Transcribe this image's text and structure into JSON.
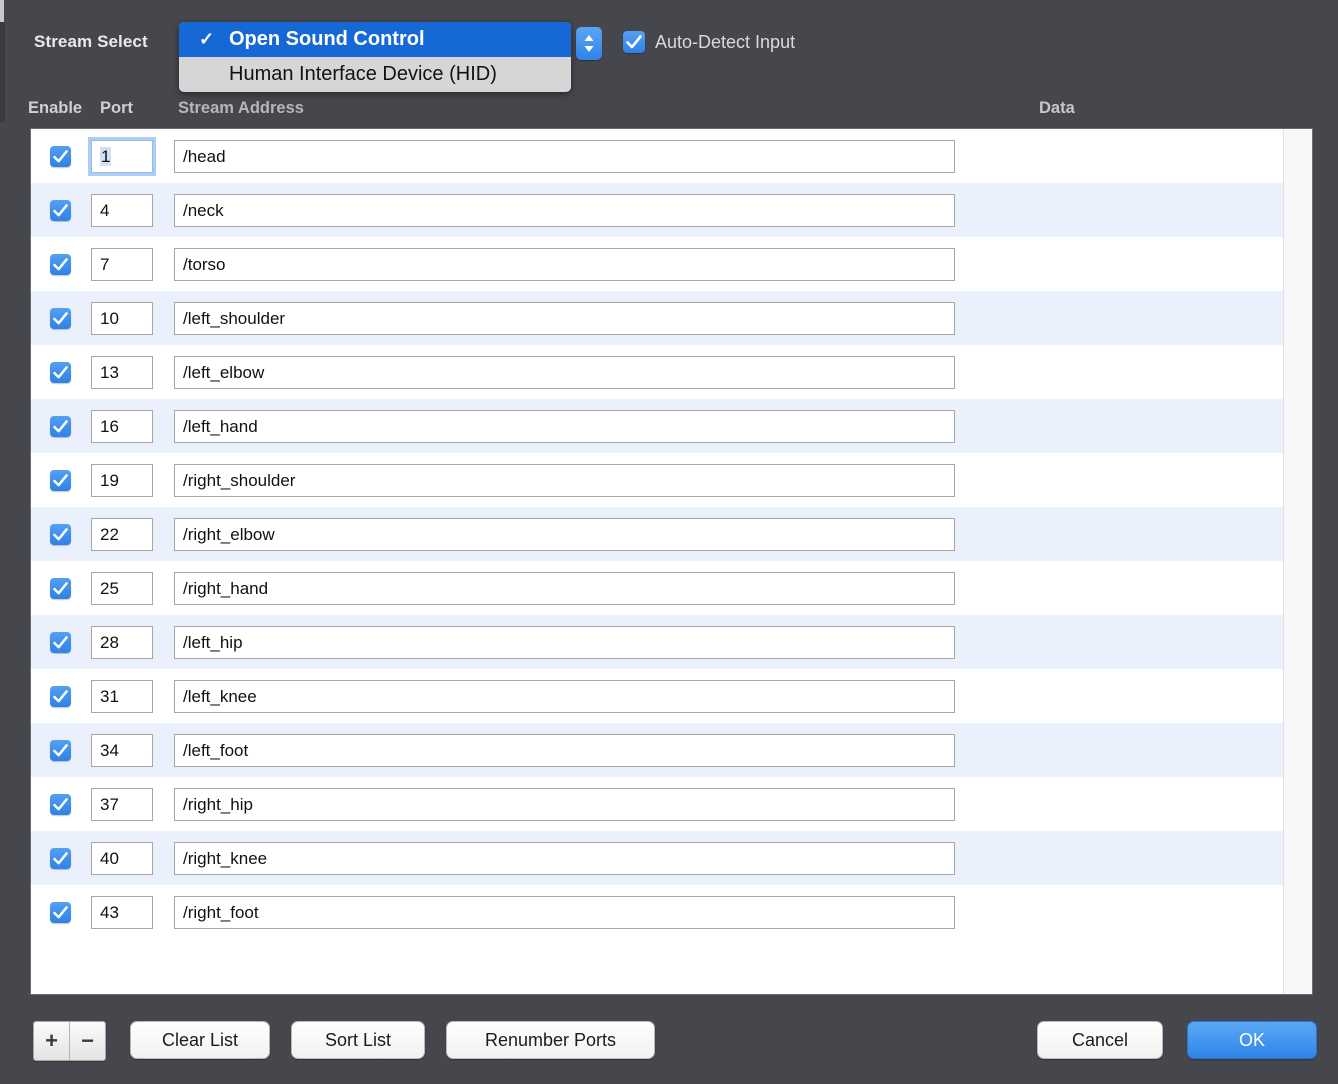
{
  "window": {
    "background_color": "#46464d",
    "accent_color": "#2f85e9"
  },
  "header": {
    "stream_select_label": "Stream Select",
    "auto_detect": {
      "label": "Auto-Detect Input",
      "checked": true
    },
    "stream_type_menu": {
      "open": true,
      "selected": "Open Sound Control",
      "options": [
        {
          "label": "Open Sound Control",
          "checked": true
        },
        {
          "label": "Human Interface Device (HID)",
          "checked": false
        }
      ],
      "checkmark_glyph": "✓"
    }
  },
  "table": {
    "columns": {
      "enable": "Enable",
      "port": "Port",
      "address": "Stream Address",
      "data": "Data"
    },
    "rows": [
      {
        "enabled": true,
        "port": "1",
        "address": "/head",
        "data": "",
        "focused": true
      },
      {
        "enabled": true,
        "port": "4",
        "address": "/neck",
        "data": "",
        "focused": false
      },
      {
        "enabled": true,
        "port": "7",
        "address": "/torso",
        "data": "",
        "focused": false
      },
      {
        "enabled": true,
        "port": "10",
        "address": "/left_shoulder",
        "data": "",
        "focused": false
      },
      {
        "enabled": true,
        "port": "13",
        "address": "/left_elbow",
        "data": "",
        "focused": false
      },
      {
        "enabled": true,
        "port": "16",
        "address": "/left_hand",
        "data": "",
        "focused": false
      },
      {
        "enabled": true,
        "port": "19",
        "address": "/right_shoulder",
        "data": "",
        "focused": false
      },
      {
        "enabled": true,
        "port": "22",
        "address": "/right_elbow",
        "data": "",
        "focused": false
      },
      {
        "enabled": true,
        "port": "25",
        "address": "/right_hand",
        "data": "",
        "focused": false
      },
      {
        "enabled": true,
        "port": "28",
        "address": "/left_hip",
        "data": "",
        "focused": false
      },
      {
        "enabled": true,
        "port": "31",
        "address": "/left_knee",
        "data": "",
        "focused": false
      },
      {
        "enabled": true,
        "port": "34",
        "address": "/left_foot",
        "data": "",
        "focused": false
      },
      {
        "enabled": true,
        "port": "37",
        "address": "/right_hip",
        "data": "",
        "focused": false
      },
      {
        "enabled": true,
        "port": "40",
        "address": "/right_knee",
        "data": "",
        "focused": false
      },
      {
        "enabled": true,
        "port": "43",
        "address": "/right_foot",
        "data": "",
        "focused": false
      }
    ]
  },
  "footer": {
    "add_label": "+",
    "remove_label": "−",
    "clear_list_label": "Clear List",
    "sort_list_label": "Sort List",
    "renumber_ports_label": "Renumber Ports",
    "cancel_label": "Cancel",
    "ok_label": "OK"
  }
}
